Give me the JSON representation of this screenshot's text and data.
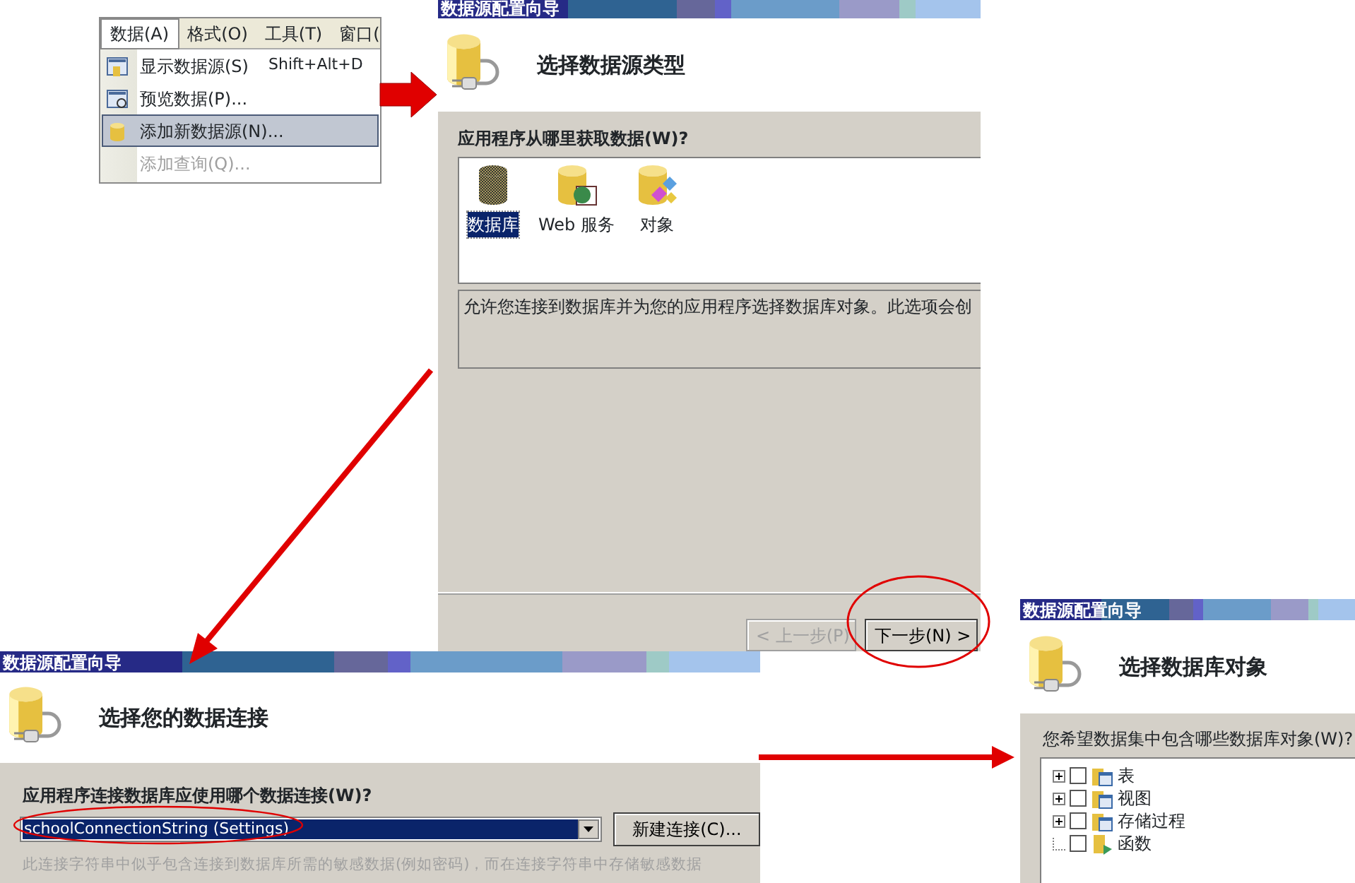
{
  "menu": {
    "bar": [
      {
        "label": "数据(A)",
        "selected": true
      },
      {
        "label": "格式(O)",
        "selected": false
      },
      {
        "label": "工具(T)",
        "selected": false
      },
      {
        "label": "窗口(",
        "selected": false
      }
    ],
    "items": [
      {
        "label": "显示数据源(S)",
        "shortcut": "Shift+Alt+D",
        "selected": false,
        "disabled": false
      },
      {
        "label": "预览数据(P)...",
        "selected": false,
        "disabled": false
      },
      {
        "label": "添加新数据源(N)...",
        "selected": true,
        "disabled": false
      },
      {
        "label": "添加查询(Q)...",
        "selected": false,
        "disabled": true
      }
    ]
  },
  "wizard_source_type": {
    "title": "数据源配置向导",
    "heading": "选择数据源类型",
    "prompt": "应用程序从哪里获取数据(W)?",
    "types": [
      {
        "label": "数据库",
        "kind": "database",
        "selected": true
      },
      {
        "label": "Web 服务",
        "kind": "web",
        "selected": false
      },
      {
        "label": "对象",
        "kind": "object",
        "selected": false
      }
    ],
    "description": "允许您连接到数据库并为您的应用程序选择数据库对象。此选项会创",
    "buttons": [
      {
        "label": "< 上一步(P)",
        "disabled": true
      },
      {
        "label": "下一步(N) >",
        "disabled": false
      }
    ]
  },
  "wizard_connection": {
    "title": "数据源配置向导",
    "heading": "选择您的数据连接",
    "prompt": "应用程序连接数据库应使用哪个数据连接(W)?",
    "connection": "schoolConnectionString (Settings)",
    "new_button": "新建连接(C)...",
    "note": "此连接字符串中似乎包含连接到数据库所需的敏感数据(例如密码)，而在连接字符串中存储敏感数据"
  },
  "wizard_objects": {
    "title": "数据源配置向导",
    "heading": "选择数据库对象",
    "prompt": "您希望数据集中包含哪些数据库对象(W)?",
    "tree": [
      {
        "label": "表",
        "kind": "expandable",
        "checked": false
      },
      {
        "label": "视图",
        "kind": "expandable",
        "checked": false
      },
      {
        "label": "存储过程",
        "kind": "expandable",
        "checked": false
      },
      {
        "label": "函数",
        "kind": "leaf",
        "checked": false
      }
    ]
  }
}
